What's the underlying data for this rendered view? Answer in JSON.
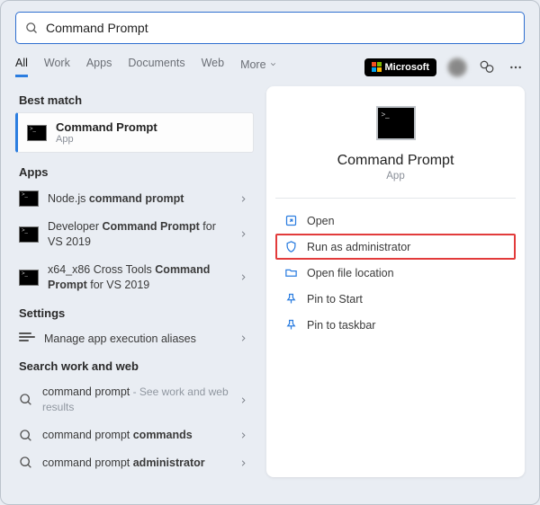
{
  "search": {
    "value": "Command Prompt"
  },
  "tabs": {
    "all": "All",
    "work": "Work",
    "apps": "Apps",
    "documents": "Documents",
    "web": "Web",
    "more": "More"
  },
  "header": {
    "microsoft": "Microsoft"
  },
  "sections": {
    "best_match": "Best match",
    "apps": "Apps",
    "settings": "Settings",
    "search_ww": "Search work and web"
  },
  "best_match": {
    "title": "Command Prompt",
    "subtitle": "App"
  },
  "app_results": [
    {
      "pre": "Node.js ",
      "bold": "command prompt",
      "post": ""
    },
    {
      "pre": "Developer ",
      "bold": "Command Prompt",
      "post": " for VS 2019"
    },
    {
      "pre": "x64_x86 Cross Tools ",
      "bold": "Command Prompt",
      "post": " for VS 2019"
    }
  ],
  "settings_results": [
    {
      "label": "Manage app execution aliases"
    }
  ],
  "web_results": [
    {
      "q": "command prompt",
      "hint": " - See work and web results"
    },
    {
      "q": "command prompt ",
      "bold": "commands"
    },
    {
      "q": "command prompt ",
      "bold": "administrator"
    }
  ],
  "preview": {
    "title": "Command Prompt",
    "subtitle": "App",
    "actions": {
      "open": "Open",
      "run_admin": "Run as administrator",
      "open_loc": "Open file location",
      "pin_start": "Pin to Start",
      "pin_taskbar": "Pin to taskbar"
    }
  }
}
